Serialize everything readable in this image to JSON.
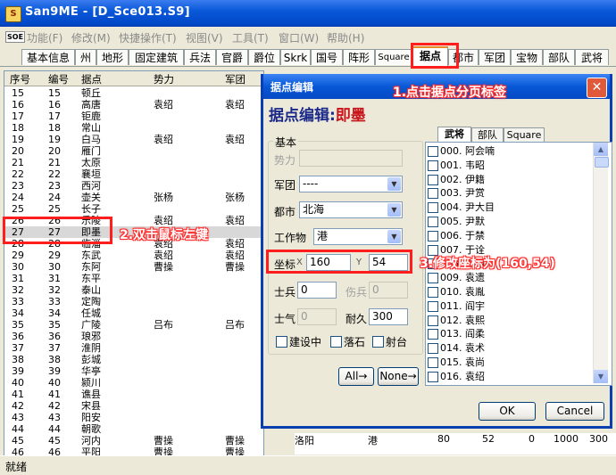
{
  "window": {
    "title": "San9ME - [D_Sce013.S9]"
  },
  "menubar": {
    "logo": "SOE",
    "items": [
      "功能(F)",
      "修改(M)",
      "快捷操作(T)",
      "视图(V)",
      "工具(T)",
      "窗口(W)",
      "帮助(H)"
    ]
  },
  "tabs": [
    "基本信息",
    "州",
    "地形",
    "固定建筑",
    "兵法",
    "官爵",
    "爵位",
    "Skrk",
    "国号",
    "阵形",
    "Square",
    "据点",
    "都市",
    "军团",
    "宝物",
    "部队",
    "武将"
  ],
  "active_tab": "据点",
  "table": {
    "headers": [
      "序号",
      "编号",
      "据点",
      "势力",
      "军团"
    ],
    "rows": [
      [
        "15",
        "15",
        "顿丘",
        "",
        ""
      ],
      [
        "16",
        "16",
        "高唐",
        "袁绍",
        "袁绍"
      ],
      [
        "17",
        "17",
        "钜鹿",
        "",
        ""
      ],
      [
        "18",
        "18",
        "常山",
        "",
        ""
      ],
      [
        "19",
        "19",
        "白马",
        "袁绍",
        "袁绍"
      ],
      [
        "20",
        "20",
        "雁门",
        "",
        ""
      ],
      [
        "21",
        "21",
        "太原",
        "",
        ""
      ],
      [
        "22",
        "22",
        "襄垣",
        "",
        ""
      ],
      [
        "23",
        "23",
        "西河",
        "",
        ""
      ],
      [
        "24",
        "24",
        "壶关",
        "张杨",
        "张杨"
      ],
      [
        "25",
        "25",
        "长子",
        "",
        ""
      ],
      [
        "26",
        "26",
        "乐陵",
        "袁绍",
        "袁绍"
      ],
      [
        "27",
        "27",
        "即墨",
        "",
        ""
      ],
      [
        "28",
        "28",
        "临淄",
        "袁绍",
        "袁绍"
      ],
      [
        "29",
        "29",
        "东武",
        "袁绍",
        "袁绍"
      ],
      [
        "30",
        "30",
        "东阿",
        "曹操",
        "曹操"
      ],
      [
        "31",
        "31",
        "东平",
        "",
        ""
      ],
      [
        "32",
        "32",
        "泰山",
        "",
        ""
      ],
      [
        "33",
        "33",
        "定陶",
        "",
        ""
      ],
      [
        "34",
        "34",
        "任城",
        "",
        ""
      ],
      [
        "35",
        "35",
        "广陵",
        "吕布",
        "吕布"
      ],
      [
        "36",
        "36",
        "琅邪",
        "",
        ""
      ],
      [
        "37",
        "37",
        "淮阴",
        "",
        ""
      ],
      [
        "38",
        "38",
        "彭城",
        "",
        ""
      ],
      [
        "39",
        "39",
        "华亭",
        "",
        ""
      ],
      [
        "40",
        "40",
        "颍川",
        "",
        ""
      ],
      [
        "41",
        "41",
        "谯县",
        "",
        ""
      ],
      [
        "42",
        "42",
        "宋县",
        "",
        ""
      ],
      [
        "43",
        "43",
        "阳安",
        "",
        ""
      ],
      [
        "44",
        "44",
        "朝歌",
        "",
        ""
      ],
      [
        "45",
        "45",
        "河内",
        "曹操",
        "曹操"
      ],
      [
        "46",
        "46",
        "平阳",
        "曹操",
        "曹操"
      ]
    ],
    "extra_row_45": [
      "洛阳",
      "港",
      "80",
      "52",
      "0",
      "1000",
      "300"
    ]
  },
  "status": "就绪",
  "dialog": {
    "title": "据点编辑",
    "heading_prefix": "据点编辑:",
    "heading_name": "即墨",
    "group_basic": "基本",
    "label_force": "势力",
    "label_corps": "军团",
    "corps_value": "----",
    "label_city": "都市",
    "city_value": "北海",
    "label_building": "工作物",
    "building_value": "港",
    "label_coord": "坐标",
    "label_x": "X",
    "x_value": "160",
    "label_y": "Y",
    "y_value": "54",
    "label_soldier": "士兵",
    "soldier_value": "0",
    "label_wounded": "伤兵",
    "wounded_value": "0",
    "label_morale": "士气",
    "morale_value": "0",
    "label_durability": "耐久",
    "durability_value": "300",
    "chk_building": "建设中",
    "chk_rockfall": "落石",
    "chk_shooting": "射台",
    "btn_all": "All→",
    "btn_none": "None→",
    "btn_ok": "OK",
    "btn_cancel": "Cancel",
    "right_tabs": [
      "武将",
      "部队",
      "Square"
    ],
    "officers": [
      "000. 阿会喃",
      "001. 韦昭",
      "002. 伊籍",
      "003. 尹赏",
      "004. 尹大目",
      "005. 尹默",
      "006. 于禁",
      "007. 于诠",
      "008. 虞翻",
      "009. 袁遗",
      "010. 袁胤",
      "011. 阎宇",
      "012. 袁熙",
      "013. 阎柔",
      "014. 袁术",
      "015. 袁尚",
      "016. 袁绍"
    ]
  },
  "annotations": {
    "step1": "1.点击据点分页标签",
    "step2": "2.双击鼠标左键",
    "step3": "3.修改座标为(160,54)",
    "color": "#ff1e1e"
  }
}
